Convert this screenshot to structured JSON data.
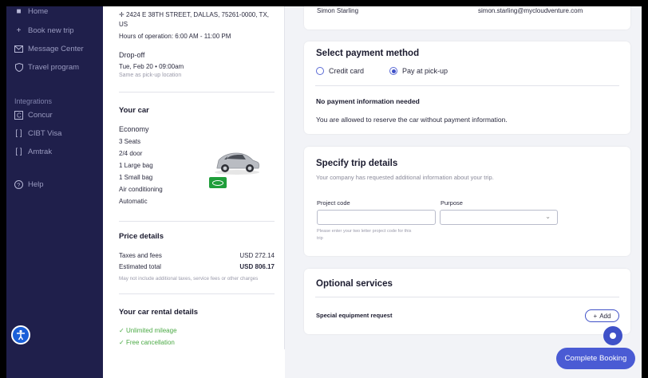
{
  "sidebar": {
    "items": [
      {
        "label": "Home",
        "icon": "home-icon"
      },
      {
        "label": "Book new trip",
        "icon": "plus-icon"
      },
      {
        "label": "Message Center",
        "icon": "mail-icon"
      },
      {
        "label": "Travel program",
        "icon": "shield-icon"
      }
    ],
    "integrations_label": "Integrations",
    "integrations": [
      {
        "label": "Concur",
        "icon": "concur-icon"
      },
      {
        "label": "CIBT Visa",
        "icon": "bracket-icon"
      },
      {
        "label": "Amtrak",
        "icon": "bracket-icon"
      }
    ],
    "help_label": "Help"
  },
  "summary": {
    "pickup_address": "2424 E 38TH STREET, DALLAS, 75261-0000, TX,",
    "pickup_address_line2": "US",
    "hours": "Hours of operation: 6:00 AM - 11:00 PM",
    "dropoff_heading": "Drop-off",
    "dropoff_datetime": "Tue, Feb 20 • 09:00am",
    "dropoff_location": "Same as pick-up location",
    "your_car_heading": "Your car",
    "car_class": "Economy",
    "car_features": [
      "3 Seats",
      "2/4 door",
      "1 Large bag",
      "1 Small bag",
      "Air conditioning",
      "Automatic"
    ],
    "price_heading": "Price details",
    "taxes_label": "Taxes and fees",
    "taxes_value": "USD 272.14",
    "total_label": "Estimated total",
    "total_value": "USD 806.17",
    "price_note": "May not include additional taxes, service fees or other charges",
    "rental_heading": "Your car rental details",
    "rental_perks": [
      "Unlimited mileage",
      "Free cancellation"
    ]
  },
  "traveler": {
    "name": "Simon Starling",
    "email": "simon.starling@mycloudventure.com"
  },
  "payment": {
    "title": "Select payment method",
    "options": [
      "Credit card",
      "Pay at pick-up"
    ],
    "selected": "Pay at pick-up",
    "info_title": "No payment information needed",
    "info_text": "You are allowed to reserve the car without payment information."
  },
  "trip_details": {
    "title": "Specify trip details",
    "subtitle": "Your company has requested additional information about your trip.",
    "project_code_label": "Project code",
    "project_code_value": "",
    "project_code_hint_1": "Please enter your two letter project code for this",
    "project_code_hint_2": "trip",
    "purpose_label": "Purpose",
    "purpose_value": ""
  },
  "optional": {
    "title": "Optional services",
    "item_label": "Special equipment request",
    "add_label": "Add"
  },
  "actions": {
    "complete_label": "Complete Booking"
  },
  "colors": {
    "sidebar_bg": "#1f1f4b",
    "accent": "#4a5bd4",
    "success": "#4caa46"
  }
}
